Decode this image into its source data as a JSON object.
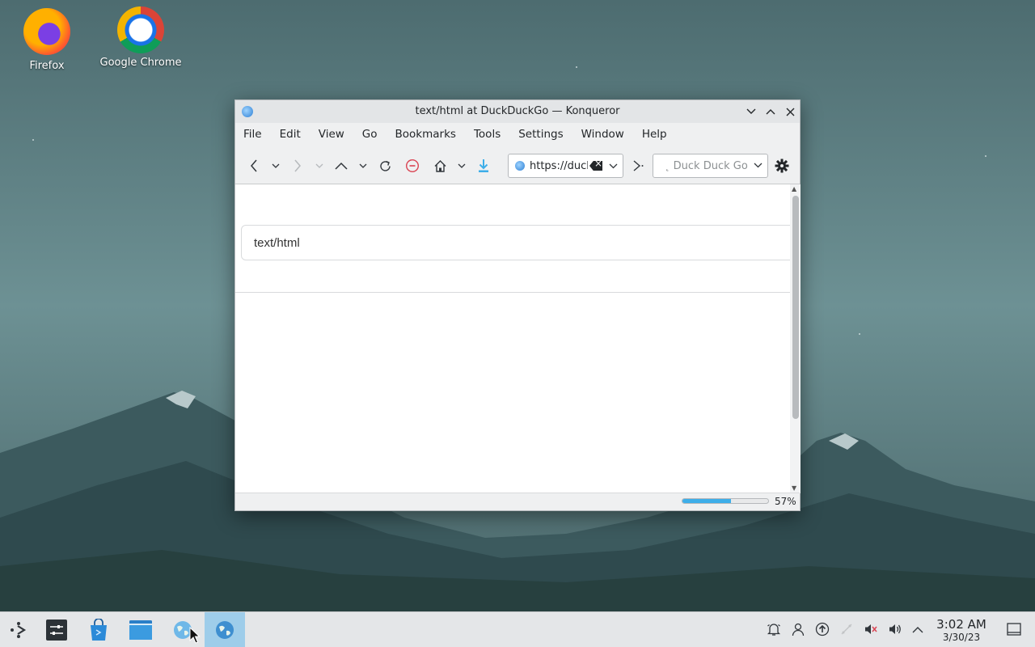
{
  "desktop": {
    "icons": [
      {
        "label": "Firefox",
        "icon": "firefox-icon"
      },
      {
        "label": "Google Chrome",
        "icon": "chrome-icon"
      }
    ]
  },
  "window": {
    "title": "text/html at DuckDuckGo — Konqueror",
    "menu": [
      "File",
      "Edit",
      "View",
      "Go",
      "Bookmarks",
      "Tools",
      "Settings",
      "Window",
      "Help"
    ],
    "toolbar": {
      "url": "https://duckduckgo.com",
      "search_placeholder": "Duck Duck Go"
    },
    "page": {
      "search_value": "text/html"
    },
    "status": {
      "progress_percent": 57,
      "progress_label": "57%"
    }
  },
  "taskbar": {
    "clock": {
      "time": "3:02 AM",
      "date": "3/30/23"
    }
  },
  "colors": {
    "accent": "#3daee9",
    "active_task": "#9ecdea",
    "stop_red": "#da4453"
  }
}
